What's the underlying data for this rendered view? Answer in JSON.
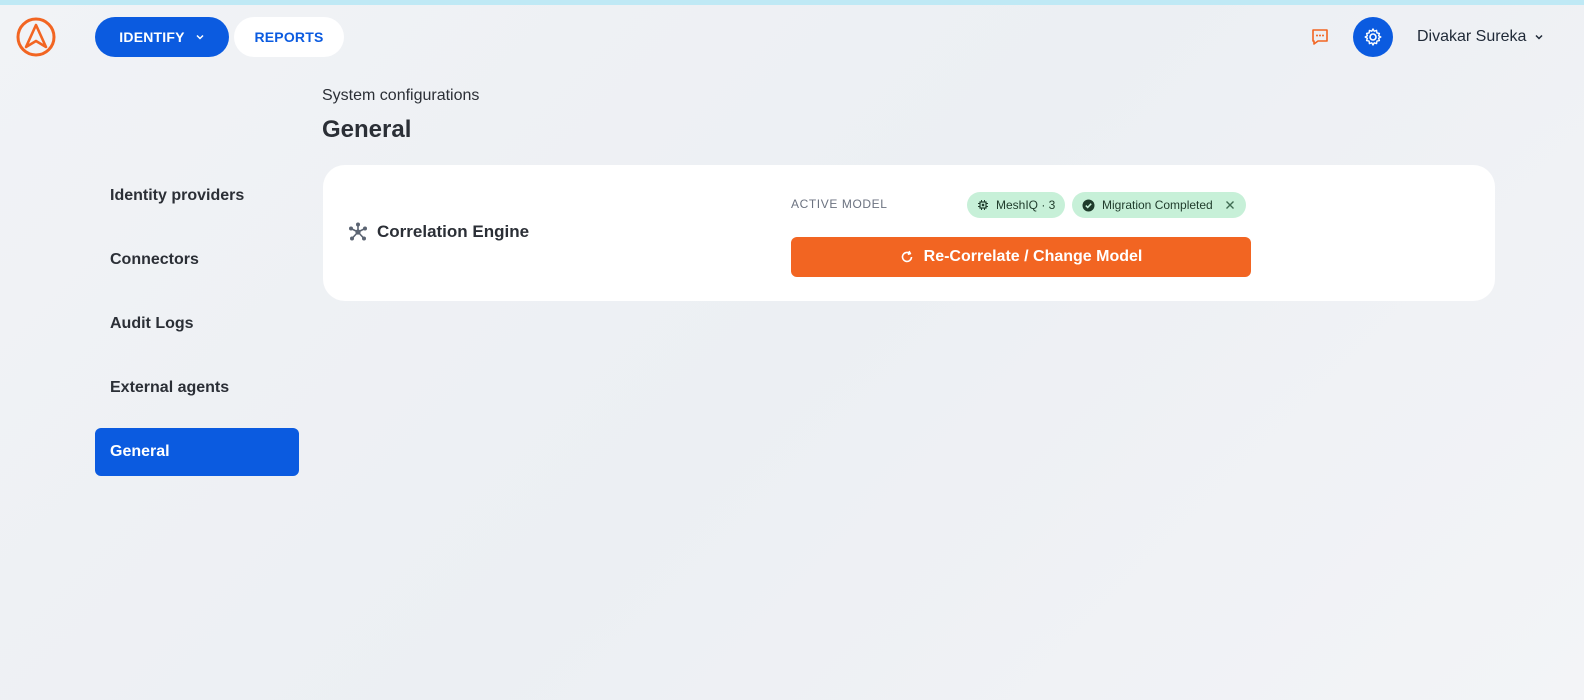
{
  "header": {
    "nav": [
      {
        "label": "IDENTIFY"
      },
      {
        "label": "REPORTS"
      }
    ],
    "user_name": "Divakar Sureka"
  },
  "sidebar": {
    "items": [
      {
        "label": "Identity providers"
      },
      {
        "label": "Connectors"
      },
      {
        "label": "Audit Logs"
      },
      {
        "label": "External agents"
      },
      {
        "label": "General",
        "active": true
      }
    ]
  },
  "main": {
    "breadcrumb": "System configurations",
    "title": "General",
    "card": {
      "name": "Correlation Engine",
      "active_model_label": "ACTIVE MODEL",
      "model_badge": "MeshIQ · 3",
      "status_badge": "Migration Completed",
      "action_label": "Re-Correlate / Change Model"
    }
  },
  "colors": {
    "primary": "#0b5be0",
    "accent": "#f26522",
    "badge_bg": "#c7f0d8"
  },
  "icons": [
    "app-logo-icon",
    "chevron-down-icon",
    "chat-icon",
    "gear-icon",
    "network-icon",
    "chip-icon",
    "check-circle-icon",
    "close-icon",
    "refresh-icon"
  ]
}
